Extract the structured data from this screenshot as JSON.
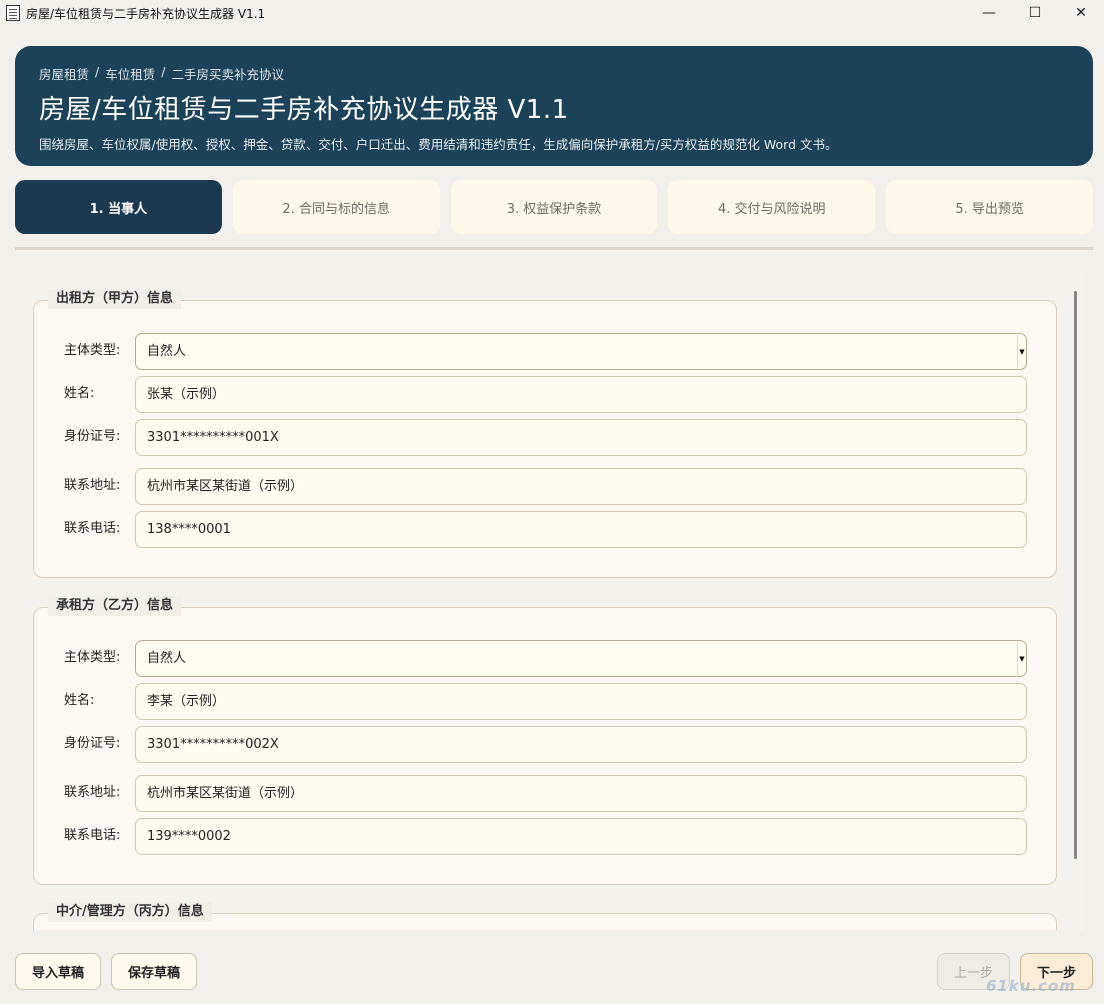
{
  "window": {
    "title": "房屋/车位租赁与二手房补充协议生成器 V1.1",
    "controls": {
      "minimize": "—",
      "maximize": "☐",
      "close": "✕"
    }
  },
  "header": {
    "breadcrumb": [
      "房屋租赁",
      "车位租赁",
      "二手房买卖补充协议"
    ],
    "breadcrumb_sep": "/",
    "title": "房屋/车位租赁与二手房补充协议生成器 V1.1",
    "subtitle": "围绕房屋、车位权属/使用权、授权、押金、贷款、交付、户口迁出、费用结清和违约责任，生成偏向保护承租方/买方权益的规范化 Word 文书。"
  },
  "steps": [
    {
      "label": "1. 当事人",
      "active": true
    },
    {
      "label": "2. 合同与标的信息",
      "active": false
    },
    {
      "label": "3. 权益保护条款",
      "active": false
    },
    {
      "label": "4. 交付与风险说明",
      "active": false
    },
    {
      "label": "5. 导出预览",
      "active": false
    }
  ],
  "party_a": {
    "title": "出租方（甲方）信息",
    "type_label": "主体类型:",
    "type_value": "自然人",
    "name_label": "姓名:",
    "name_value": "张某（示例）",
    "id_label": "身份证号:",
    "id_value": "3301**********001X",
    "address_label": "联系地址:",
    "address_value": "杭州市某区某街道（示例）",
    "phone_label": "联系电话:",
    "phone_value": "138****0001"
  },
  "party_b": {
    "title": "承租方（乙方）信息",
    "type_label": "主体类型:",
    "type_value": "自然人",
    "name_label": "姓名:",
    "name_value": "李某（示例）",
    "id_label": "身份证号:",
    "id_value": "3301**********002X",
    "address_label": "联系地址:",
    "address_value": "杭州市某区某街道（示例）",
    "phone_label": "联系电话:",
    "phone_value": "139****0002"
  },
  "party_c": {
    "title": "中介/管理方（丙方）信息"
  },
  "footer": {
    "import_draft": "导入草稿",
    "save_draft": "保存草稿",
    "prev_step": "上一步",
    "next_step": "下一步"
  },
  "watermark": "61ku.com"
}
